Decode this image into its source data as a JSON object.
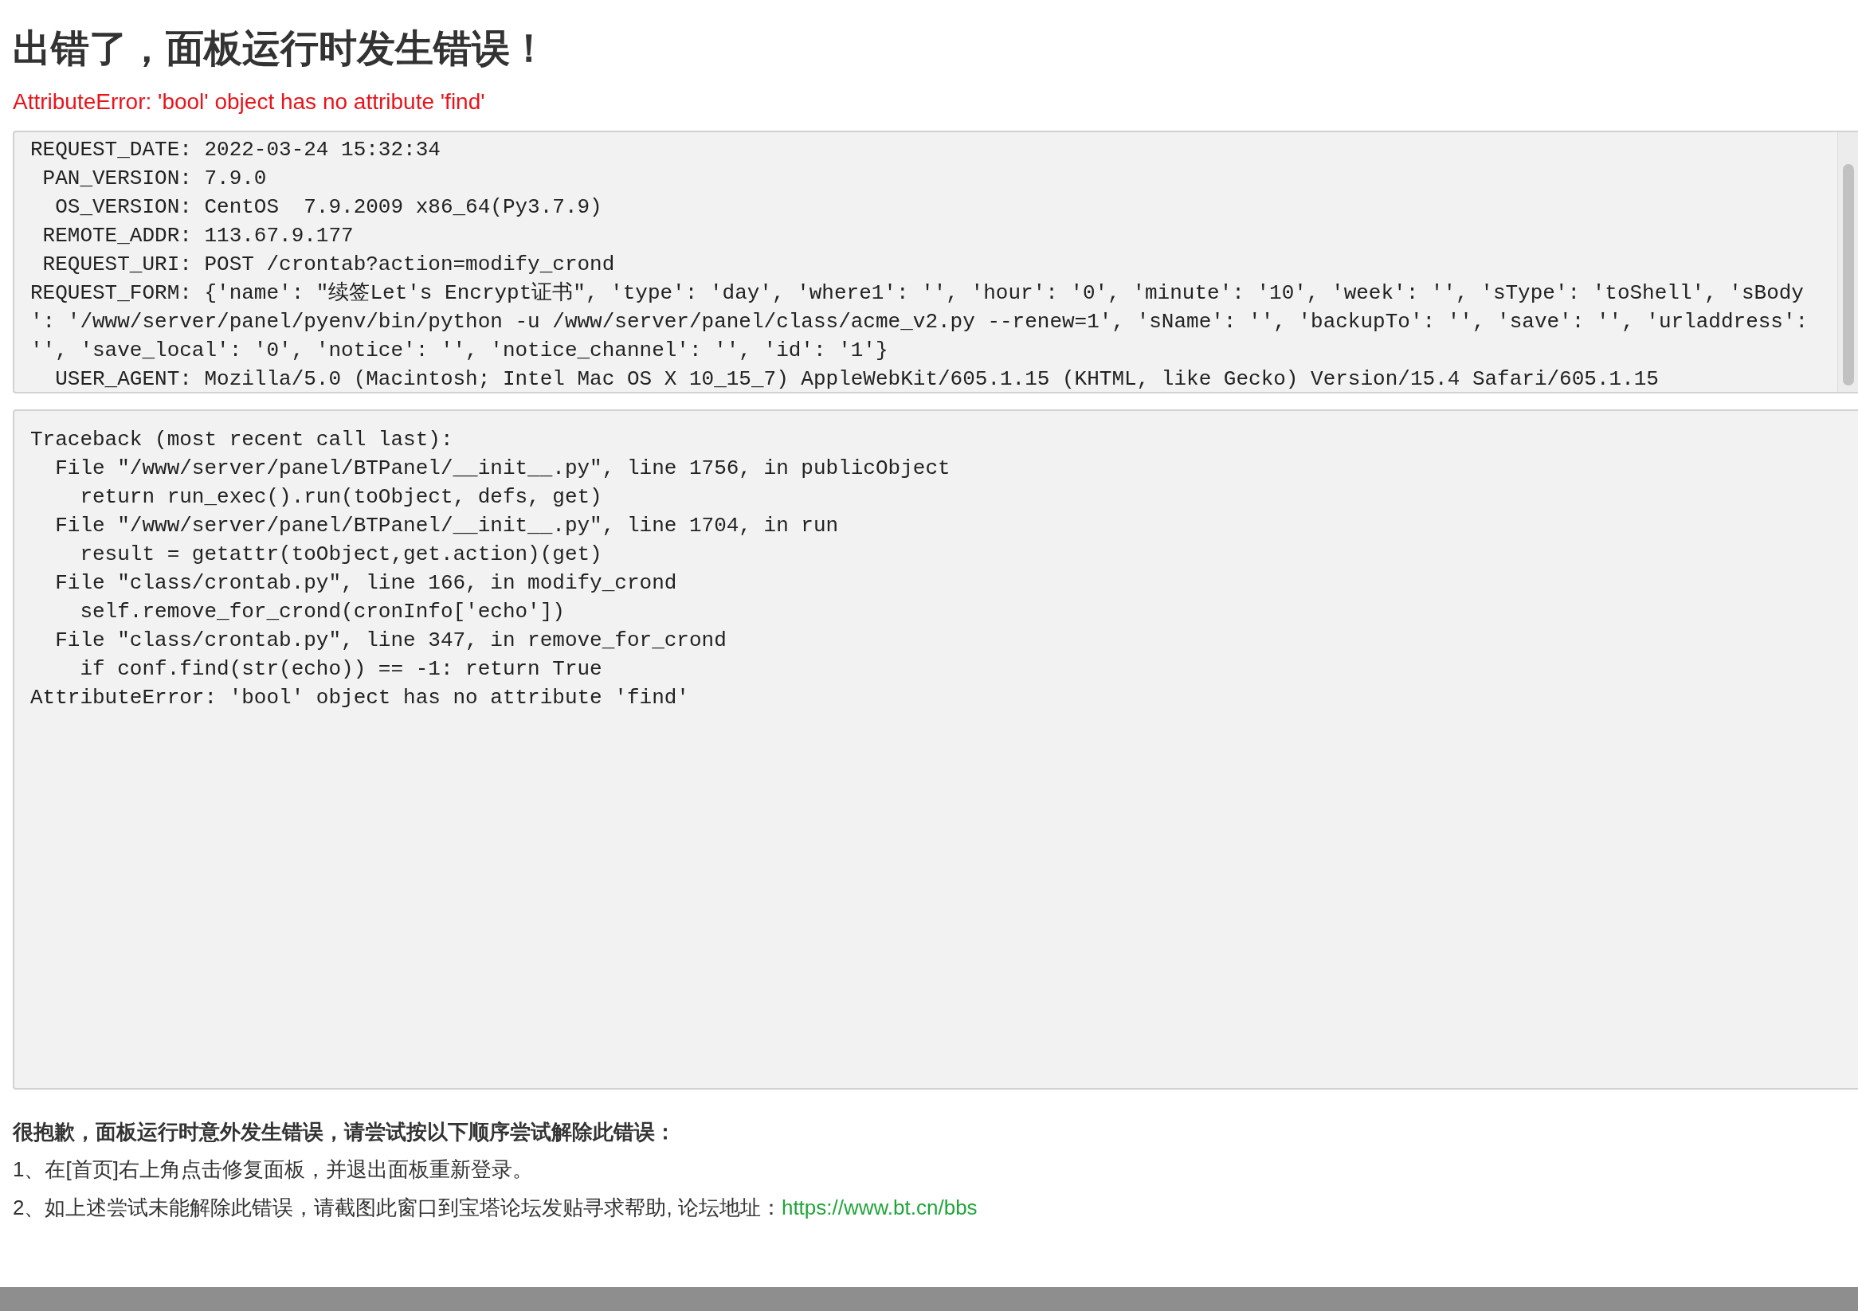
{
  "heading": "出错了，面板运行时发生错误！",
  "error_message": "AttributeError: 'bool' object has no attribute 'find'",
  "request_info": {
    "lines": [
      "REQUEST_DATE: 2022-03-24 15:32:34",
      " PAN_VERSION: 7.9.0",
      "  OS_VERSION: CentOS  7.9.2009 x86_64(Py3.7.9)",
      " REMOTE_ADDR: 113.67.9.177",
      " REQUEST_URI: POST /crontab?action=modify_crond",
      "REQUEST_FORM: {'name': \"续签Let's Encrypt证书\", 'type': 'day', 'where1': '', 'hour': '0', 'minute': '10', 'week': '', 'sType': 'toShell', 'sBody",
      "': '/www/server/panel/pyenv/bin/python -u /www/server/panel/class/acme_v2.py --renew=1', 'sName': '', 'backupTo': '', 'save': '', 'urladdress':",
      "'', 'save_local': '0', 'notice': '', 'notice_channel': '', 'id': '1'}",
      "  USER_AGENT: Mozilla/5.0 (Macintosh; Intel Mac OS X 10_15_7) AppleWebKit/605.1.15 (KHTML, like Gecko) Version/15.4 Safari/605.1.15"
    ]
  },
  "traceback": {
    "lines": [
      "Traceback (most recent call last):",
      "  File \"/www/server/panel/BTPanel/__init__.py\", line 1756, in publicObject",
      "    return run_exec().run(toObject, defs, get)",
      "  File \"/www/server/panel/BTPanel/__init__.py\", line 1704, in run",
      "    result = getattr(toObject,get.action)(get)",
      "  File \"class/crontab.py\", line 166, in modify_crond",
      "    self.remove_for_crond(cronInfo['echo'])",
      "  File \"class/crontab.py\", line 347, in remove_for_crond",
      "    if conf.find(str(echo)) == -1: return True",
      "AttributeError: 'bool' object has no attribute 'find'"
    ]
  },
  "help": {
    "title": "很抱歉，面板运行时意外发生错误，请尝试按以下顺序尝试解除此错误：",
    "steps": [
      {
        "text": "1、在[首页]右上角点击修复面板，并退出面板重新登录。"
      },
      {
        "text": "2、如上述尝试未能解除此错误，请截图此窗口到宝塔论坛发贴寻求帮助, 论坛地址：",
        "link": "https://www.bt.cn/bbs"
      }
    ]
  }
}
